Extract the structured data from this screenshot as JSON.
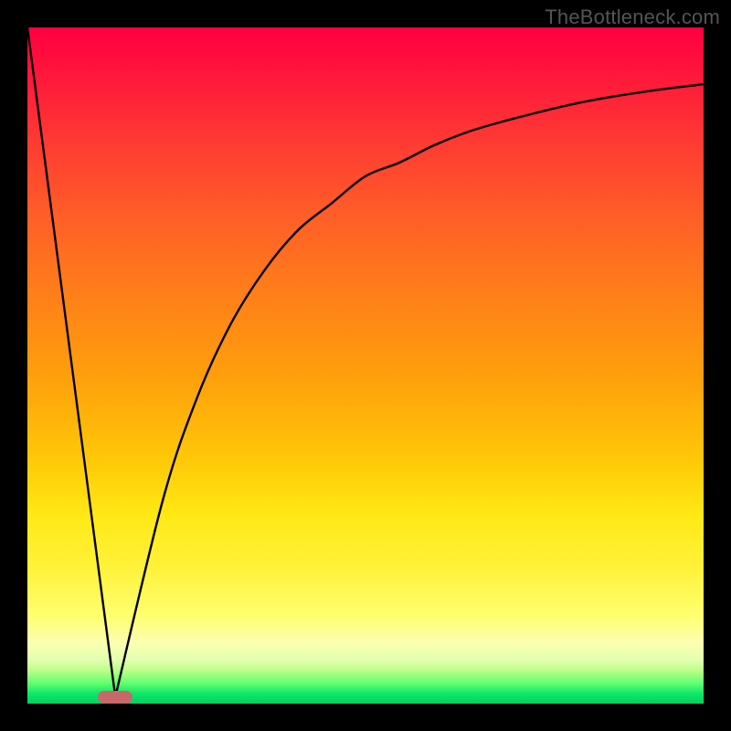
{
  "watermark": "TheBottleneck.com",
  "colors": {
    "frame": "#000000",
    "curve": "#000000",
    "marker": "#c96868",
    "gradient_top": "#ff0040",
    "gradient_bottom": "#00d060"
  },
  "chart_data": {
    "type": "line",
    "title": "",
    "xlabel": "",
    "ylabel": "",
    "xlim": [
      0,
      100
    ],
    "ylim": [
      0,
      100
    ],
    "marker": {
      "x": 13,
      "y": 1
    },
    "series": [
      {
        "name": "left-branch",
        "x": [
          0,
          13
        ],
        "values": [
          100,
          1
        ]
      },
      {
        "name": "right-branch",
        "x": [
          13,
          20,
          25,
          30,
          35,
          40,
          45,
          50,
          55,
          60,
          65,
          70,
          75,
          80,
          85,
          90,
          95,
          100
        ],
        "values": [
          1,
          30,
          45,
          56,
          64,
          70,
          74,
          78,
          80,
          82.5,
          84.5,
          86,
          87.3,
          88.5,
          89.5,
          90.3,
          91,
          91.6
        ]
      }
    ]
  }
}
